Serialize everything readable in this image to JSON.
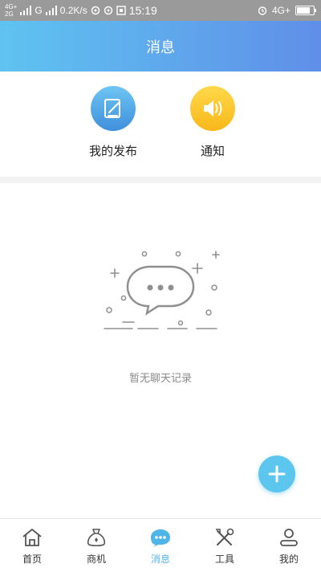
{
  "status_bar": {
    "network_top": "4G+",
    "network_bottom": "2G",
    "network_g": "G",
    "speed": "0.2K/s",
    "time": "15:19",
    "network_right": "4G+"
  },
  "header": {
    "title": "消息"
  },
  "quick_actions": [
    {
      "label": "我的发布",
      "icon": "edit-note-icon"
    },
    {
      "label": "通知",
      "icon": "speaker-icon"
    }
  ],
  "empty_state": {
    "text": "暂无聊天记录",
    "icon": "chat-bubble-icon"
  },
  "fab": {
    "icon": "plus-icon"
  },
  "tabbar": {
    "items": [
      {
        "label": "首页",
        "icon": "home-icon",
        "active": false
      },
      {
        "label": "商机",
        "icon": "money-bag-icon",
        "active": false
      },
      {
        "label": "消息",
        "icon": "message-icon",
        "active": true
      },
      {
        "label": "工具",
        "icon": "tools-icon",
        "active": false
      },
      {
        "label": "我的",
        "icon": "profile-icon",
        "active": false
      }
    ]
  },
  "colors": {
    "header_start": "#5fc3f1",
    "header_end": "#5f8fe8",
    "active_tab": "#4fb5e8",
    "fab": "#5cc6ee"
  }
}
